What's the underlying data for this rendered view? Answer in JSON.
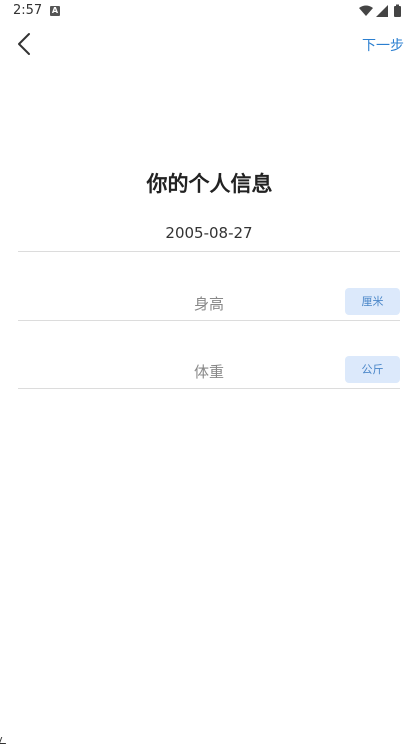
{
  "status_bar": {
    "time": "2:57",
    "notification_icon": "a-icon",
    "icons": [
      "wifi-icon",
      "signal-icon",
      "battery-icon"
    ]
  },
  "header": {
    "back_icon": "chevron-left-icon",
    "next_label": "下一步"
  },
  "form": {
    "title": "你的个人信息",
    "birthday": {
      "value": "2005-08-27"
    },
    "height": {
      "placeholder": "身高",
      "unit": "厘米"
    },
    "weight": {
      "placeholder": "体重",
      "unit": "公斤"
    }
  },
  "colors": {
    "accent": "#2b7fd0",
    "unit_tag_bg": "#dce9fb",
    "unit_tag_text": "#4a86c8"
  }
}
